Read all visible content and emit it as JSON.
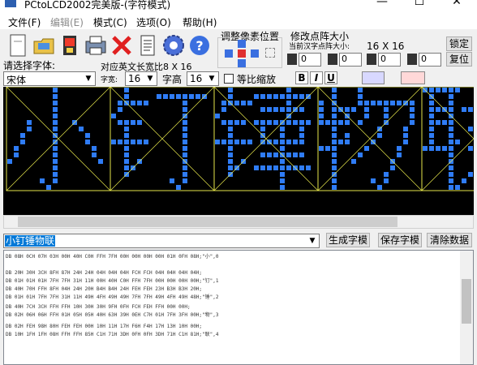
{
  "window": {
    "title": "PCtoLCD2002完美版-(字符模式)",
    "minimize": "—",
    "maximize": "☐",
    "close": "✕"
  },
  "menu": [
    {
      "label": "文件(F)",
      "enabled": true
    },
    {
      "label": "编辑(E)",
      "enabled": false
    },
    {
      "label": "模式(C)",
      "enabled": true
    },
    {
      "label": "选项(O)",
      "enabled": true
    },
    {
      "label": "帮助(H)",
      "enabled": true
    }
  ],
  "toolbar": {
    "icons": [
      "new-file-icon",
      "open-folder-icon",
      "save-icon",
      "print-icon",
      "delete-icon",
      "document-icon",
      "settings-gear-icon",
      "help-icon"
    ],
    "adjust_title": "调整像素位置",
    "resize_title": "修改点阵大小",
    "resize_subtitle": "当前汉字点阵大小:",
    "resize_value": "16 X 16",
    "lock_label": "锁定",
    "restore_label": "复位",
    "spin_values": [
      "0",
      "0",
      "0",
      "0"
    ]
  },
  "font": {
    "label": "请选择字体:",
    "value": "宋体",
    "width_label": "对应英文长宽比8 X 16",
    "char_width_label": "字宽:",
    "char_width_value": "16",
    "char_height_label": "字高",
    "char_height_value": "16",
    "proportional_label": "等比缩放",
    "bold_label": "B",
    "italic_label": "I",
    "underline_label": "U"
  },
  "input_text": "小钉锤物联",
  "buttons": {
    "generate": "生成字模",
    "save": "保存字模",
    "clear": "清除数据"
  },
  "watermark": "小钉锤物联",
  "output_lines": [
    "DB 08H 0CH 07H 03H 00H 40H C0H FFH 7FH 00H 00H 00H 00H 01H 0FH 08H;\"小\",0",
    "DB 20H 30H 3CH 8FH 87H 24H 24H 04H 04H 04H FCH FCH 04H 04H 04H 04H;",
    "DB 01H 01H 01H 7FH 7FH 31H 11H 00H 40H C0H FFH 7FH 00H 00H 00H 00H;\"钉\",1",
    "DB 40H 70H FFH 8FH 04H 24H 20H B4H B4H 24H FEH FEH 23H B3H B3H 20H;",
    "DB 01H 01H 7FH 7FH 31H 11H 49H 4FH 49H 49H 7FH 7FH 49H 4FH 49H 48H;\"锤\",2",
    "DB 40H 7CH 3CH FFH FFH 10H 30H 30H 9FH 0FH FCH FEH FFH 00H 00H;",
    "DB 02H 06H 06H FFH 01H 05H 05H 40H 63H 39H 0EH C7H 01H 7FH 3FH 00H;\"物\",3",
    "DB 02H FEH 98H 80H FEH FEH 00H 10H 11H 17H F6H F4H 17H 13H 10H 00H;",
    "DB 10H 1FH 1FH 08H FFH FFH 85H C1H 71H 3DH 0FH 0FH 3DH 71H C1H 81H;\"联\",4"
  ],
  "colors": {
    "pixel_on": "#2f7cf6",
    "grid_frame": "#e6e64a",
    "background": "#000000",
    "selection": "#0078d7"
  }
}
